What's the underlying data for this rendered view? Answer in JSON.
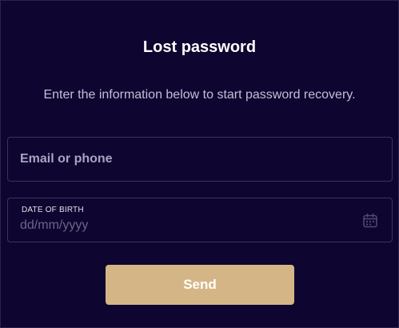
{
  "dialog": {
    "title": "Lost password",
    "subtitle": "Enter the information below to start password recovery."
  },
  "form": {
    "email": {
      "placeholder": "Email or phone",
      "value": ""
    },
    "dob": {
      "label": "DATE OF BIRTH",
      "placeholder": "dd/mm/yyyy",
      "icon": "calendar-icon"
    },
    "submit_label": "Send"
  },
  "colors": {
    "background": "#0e0530",
    "field_border": "#3a3362",
    "button": "#d4b686",
    "button_text": "#ffffff"
  }
}
